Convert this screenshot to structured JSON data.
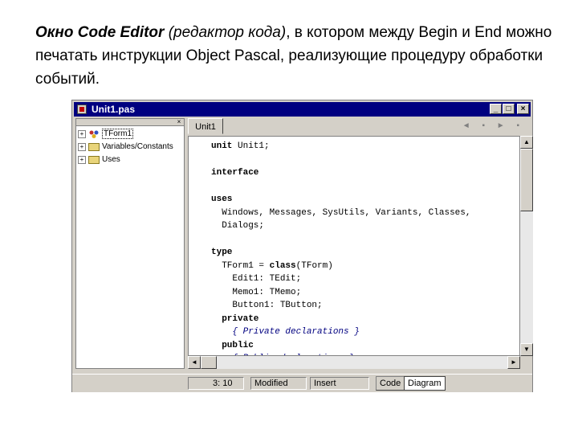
{
  "caption": {
    "part1": "Окно Code Editor",
    "part2": " (редактор кода)",
    "part3": ", в котором между Begin и End можно печатать инструкции Object Pascal, реализующие процедуру обработки событий."
  },
  "window": {
    "title": "Unit1.pas",
    "minimize": "_",
    "maximize": "□",
    "close": "×"
  },
  "explorer": {
    "close": "×",
    "items": [
      {
        "label": "TForm1",
        "expander": "+",
        "icon": "class-icon"
      },
      {
        "label": "Variables/Constants",
        "expander": "+",
        "icon": "folder-icon"
      },
      {
        "label": "Uses",
        "expander": "+",
        "icon": "folder-icon"
      }
    ]
  },
  "editor": {
    "tab": "Unit1",
    "nav": "◄ ▪ ► ▪",
    "code_lines": [
      "unit Unit1;",
      "",
      "interface",
      "",
      "uses",
      "  Windows, Messages, SysUtils, Variants, Classes,",
      "  Dialogs;",
      "",
      "type",
      "  TForm1 = class(TForm)",
      "    Edit1: TEdit;",
      "    Memo1: TMemo;",
      "    Button1: TButton;",
      "  private",
      "    { Private declarations }",
      "  public",
      "    { Public declarations }"
    ]
  },
  "status": {
    "position": "3: 10",
    "modified": "Modified",
    "insert": "Insert",
    "tab_code": "Code",
    "tab_diagram": "Diagram"
  }
}
